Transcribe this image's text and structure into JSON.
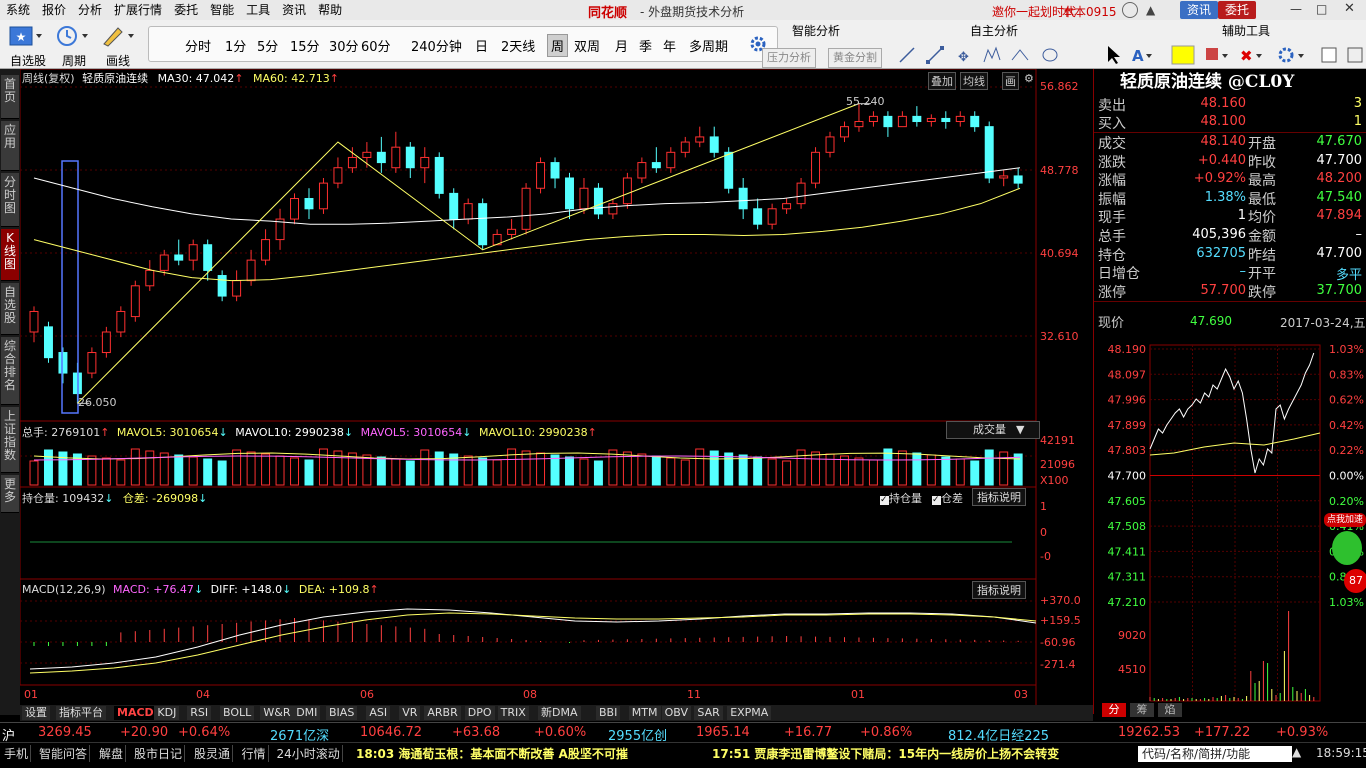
{
  "menu": [
    "系统",
    "报价",
    "分析",
    "扩展行情",
    "委托",
    "智能",
    "工具",
    "资讯",
    "帮助"
  ],
  "brand": "同花顺",
  "brand_sub": "- 外盘期货技术分析",
  "invite": "邀你一起划时代",
  "nickname": "本本0915",
  "top_buttons": {
    "info": "资讯",
    "trade": "委托"
  },
  "toolbar": {
    "labels": [
      "自选股",
      "周期",
      "画线"
    ],
    "periods": [
      "分时",
      "1分",
      "5分",
      "15分",
      "30分",
      "60分",
      "240分钟",
      "日",
      "2天线",
      "周",
      "双周",
      "月",
      "季",
      "年",
      "多周期"
    ],
    "selected_period": "周",
    "smart_title": "智能分析",
    "smart_btns": [
      "压力分析",
      "黄金分割"
    ],
    "selfdraw_title": "自主分析",
    "assist_title": "辅助工具"
  },
  "sidebar": [
    "首页",
    "应用",
    "分时图",
    "K线图",
    "自选股",
    "综合排名",
    "上证指数",
    "更多"
  ],
  "kline": {
    "header_prefix": "周线(复权)",
    "name": "轻质原油连续",
    "ma30_label": "MA30: 47.042",
    "ma60_label": "MA60: 42.713",
    "y_labels": [
      "56.862",
      "48.778",
      "40.694",
      "32.610"
    ],
    "high_mark": "55.240",
    "low_mark": "26.050",
    "corner_tabs": [
      "叠加",
      "均线",
      "画"
    ]
  },
  "volume": {
    "label": "总手: 2769101",
    "mavol5": "MAVOL5: 3010654",
    "mavol10": "MAVOL10: 2990238",
    "mavol5b": "MAVOL5: 3010654",
    "mavol10b": "MAVOL10: 2990238",
    "selector": "成交量",
    "y_labels": [
      "42191",
      "21096"
    ],
    "unit": "X100"
  },
  "oi": {
    "label": "持仓量: 109432",
    "diff": "仓差: -269098",
    "check1": "持仓量",
    "check2": "仓差",
    "btn": "指标说明",
    "y_labels": [
      "1",
      "0",
      "-0"
    ]
  },
  "macd": {
    "label": "MACD(12,26,9)",
    "macd": "MACD: +76.47",
    "diff": "DIFF: +148.0",
    "dea": "DEA: +109.8",
    "btn": "指标说明",
    "y_labels": [
      "+370.0",
      "+159.5",
      "-60.96",
      "-271.4"
    ]
  },
  "x_labels": [
    "01",
    "04",
    "06",
    "08",
    "11",
    "01",
    "03"
  ],
  "bottom_tabs": [
    "设置",
    "指标平台",
    "MACD",
    "KDJ",
    "RSI",
    "BOLL",
    "W&R",
    "DMI",
    "BIAS",
    "ASI",
    "VR",
    "ARBR",
    "DPO",
    "TRIX",
    "新DMA",
    "BBI",
    "MTM",
    "OBV",
    "SAR",
    "EXPMA"
  ],
  "active_tab": "MACD",
  "quote": {
    "title": "轻质原油连续 @CL0Y",
    "sell_label": "卖出",
    "sell": "48.160",
    "sell_vol": "3",
    "buy_label": "买入",
    "buy": "48.100",
    "buy_vol": "1",
    "rows": [
      {
        "l1": "成交",
        "v1": "48.140",
        "l2": "开盘",
        "v2": "47.670",
        "c1": "#ff4040",
        "c2": "#40ff40"
      },
      {
        "l1": "涨跌",
        "v1": "+0.440",
        "l2": "昨收",
        "v2": "47.700",
        "c1": "#ff4040",
        "c2": "#ffffff"
      },
      {
        "l1": "涨幅",
        "v1": "+0.92%",
        "l2": "最高",
        "v2": "48.200",
        "c1": "#ff4040",
        "c2": "#ff4040"
      },
      {
        "l1": "振幅",
        "v1": "1.38%",
        "l2": "最低",
        "v2": "47.540",
        "c1": "#55ddff",
        "c2": "#40ff40"
      },
      {
        "l1": "现手",
        "v1": "1",
        "l2": "均价",
        "v2": "47.894",
        "c1": "#ffffff",
        "c2": "#ff4040"
      },
      {
        "l1": "总手",
        "v1": "405,396",
        "l2": "金额",
        "v2": "–",
        "c1": "#ffffff",
        "c2": "#ffffff"
      },
      {
        "l1": "持仓",
        "v1": "632705",
        "l2": "昨结",
        "v2": "47.700",
        "c1": "#55ddff",
        "c2": "#ffffff"
      },
      {
        "l1": "日增仓",
        "v1": "–",
        "l2": "开平",
        "v2": "多平",
        "c1": "#55ddff",
        "c2": "#55ddff"
      },
      {
        "l1": "涨停",
        "v1": "57.700",
        "l2": "跌停",
        "v2": "37.700",
        "c1": "#ff4040",
        "c2": "#40ff40"
      }
    ],
    "now_label": "现价",
    "now": "47.690",
    "date": "2017-03-24,五",
    "mini_left": [
      "48.190",
      "48.097",
      "47.996",
      "47.899",
      "47.803",
      "47.700",
      "47.605",
      "47.508",
      "47.411",
      "47.311",
      "47.210",
      "9020",
      "4510"
    ],
    "mini_right": [
      "1.03%",
      "0.83%",
      "0.62%",
      "0.42%",
      "0.22%",
      "0.00%",
      "0.20%",
      "0.41%",
      "0.62%",
      "0.82%",
      "1.03%"
    ],
    "promo": "点我加速",
    "promo_num": "87",
    "tabs": [
      "分",
      "筹",
      "焰"
    ]
  },
  "ticker": [
    {
      "t": "沪",
      "c": "#ffffff"
    },
    {
      "t": "3269.45",
      "c": "#ff4040"
    },
    {
      "t": "+20.90",
      "c": "#ff4040"
    },
    {
      "t": "+0.64%",
      "c": "#ff4040"
    },
    {
      "t": "2671亿深",
      "c": "#55ddff"
    },
    {
      "t": "10646.72",
      "c": "#ff4040"
    },
    {
      "t": "+63.68",
      "c": "#ff4040"
    },
    {
      "t": "+0.60%",
      "c": "#ff4040"
    },
    {
      "t": "2955亿创",
      "c": "#55ddff"
    },
    {
      "t": "1965.14",
      "c": "#ff4040"
    },
    {
      "t": "+16.77",
      "c": "#ff4040"
    },
    {
      "t": "+0.86%",
      "c": "#ff4040"
    },
    {
      "t": "812.4亿日经225",
      "c": "#55ddff"
    },
    {
      "t": "19262.53",
      "c": "#ff4040"
    },
    {
      "t": "+177.22",
      "c": "#ff4040"
    },
    {
      "t": "+0.93%",
      "c": "#ff4040"
    }
  ],
  "status": {
    "items": [
      "手机",
      "智能问答",
      "解盘",
      "股市日记",
      "股灵通",
      "行情",
      "24小时滚动"
    ],
    "news1": "18:03 海通荀玉根：基本面不断改善 A股坚不可摧",
    "news2": "17:51 贾康李迅雷博鳌设下赌局：15年内一线房价上扬不会转变",
    "search": "代码/名称/简拼/功能",
    "clock": "18:59:15"
  },
  "colors": {
    "up": "#ff3030",
    "down": "#55ffff",
    "ma30": "#ffffff",
    "ma60": "#ffff66",
    "accent": "#c00000"
  }
}
